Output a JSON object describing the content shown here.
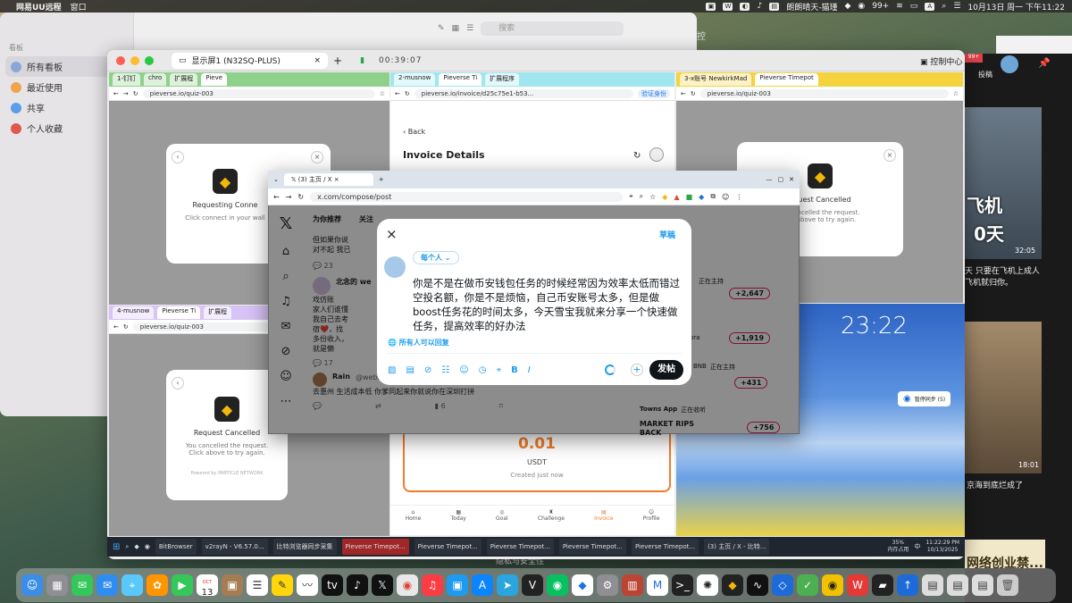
{
  "menubar": {
    "app_name": "网易UU远程",
    "menu_window": "窗口",
    "tray_badge": "99+",
    "weather": "朗朗晴天-猫瑾",
    "input_indicator": "A",
    "datetime": "10月13日 周一 下午11:22"
  },
  "finder": {
    "section": "看板",
    "items": [
      "所有看板",
      "最近使用",
      "共享",
      "个人收藏"
    ],
    "search_placeholder": "搜索",
    "control_label": "控"
  },
  "remote": {
    "tab_title": "显示屏1 (N32SQ-PLUS)",
    "timer": "00:39:07",
    "control_center": "控制中心"
  },
  "q1": {
    "tabs": [
      "1-钉钉",
      "chro",
      "扩展程",
      "Pieve"
    ],
    "url": "pieverse.io/quiz-003",
    "modal_title": "Requesting Conne",
    "modal_sub": "Click connect in your wall"
  },
  "q2": {
    "tabs": [
      "2-musnow",
      "Pieverse Ti",
      "扩展程序"
    ],
    "url": "pieverse.io/invoice/d25c75e1-b53...",
    "badge": "验证身份",
    "back": "Back",
    "title": "Invoice Details",
    "amount": "0.01",
    "currency": "USDT",
    "created": "Created just now",
    "nav": [
      "Home",
      "Today",
      "Goal",
      "Challenge",
      "Invoice",
      "Profile"
    ]
  },
  "q3": {
    "tabs": [
      "3-x账号 NewkirkMad",
      "Pieverse Timepot"
    ],
    "url": "pieverse.io/quiz-003",
    "modal_title": "equest Cancelled",
    "modal_sub1": "ou cancelled the request.",
    "modal_sub2": "lick above to try again."
  },
  "q4": {
    "tabs": [
      "4-musnow",
      "Pieverse Ti",
      "扩展程"
    ],
    "url": "pieverse.io/quiz-003",
    "modal_title": "Request Cancelled",
    "modal_sub1": "You cancelled the request.",
    "modal_sub2": "Click above to try again.",
    "powered": "Powered by PARTICLE NETWORK"
  },
  "wallpaper": {
    "clock": "23:22",
    "sync_label": "暂停同步 (5)"
  },
  "right_bg": {
    "title1": "飞机",
    "title1b": "0天",
    "dur1": "32:05",
    "text1": "天 只要在飞机上成人飞机就归你。",
    "dur2": "18:01",
    "text2": "京海到底烂成了",
    "tray": "投稿"
  },
  "xwin": {
    "tab_title": "(3) 主页 / X",
    "url": "x.com/compose/post",
    "feed_tabs": [
      "为你推荐",
      "关注"
    ],
    "feed_text1": "但如果你说",
    "feed_text2": "对不起 我已",
    "reply_count1": "23",
    "user2": "北念的 we",
    "user2_sub": "戏仿账",
    "feed_text3": "家人们谁懂",
    "feed_text4": "我自己去考",
    "feed_text5": "宿❤️，找",
    "feed_text6": "多份收入，",
    "feed_text7": "就是懒",
    "reply_count2": "17",
    "user3": "Rain",
    "user3_handle": "@web3Rain_ · 40分钟",
    "feed_text8": "去惠州 生活成本低 你爹同起来你就说你在深圳打拼",
    "views": "6",
    "right_live1": "正在主持",
    "right_count1": "+2,647",
    "right_text2": "ora",
    "right_count2": "+1,919",
    "right_text3": "BNB",
    "right_live3": "正在主持",
    "right_count3": "+431",
    "right_town": "Towns App",
    "right_live4": "正在收听",
    "right_rips": "MARKET RIPS",
    "right_rips2": "BACK",
    "right_count4": "+756"
  },
  "compose": {
    "close": "×",
    "drafts": "草稿",
    "audience": "每个人",
    "text": "你是不是在做币安钱包任务的时候经常因为效率太低而错过空投名额，你是不是烦恼，自己币安账号太多，但是做boost任务花的时间太多，今天雪宝我就来分享一个快速做任务，提高效率的好办法",
    "reply_setting": "所有人可以回复",
    "post_button": "发帖",
    "add": "+"
  },
  "taskbar": {
    "items": [
      "BitBrowser",
      "v2rayN - V6.57.0...",
      "比特浏览器同步采集",
      "Pieverse Timepot...",
      "Pieverse Timepot...",
      "Pieverse Timepot...",
      "Pieverse Timepot...",
      "Pieverse Timepot...",
      "(3) 主页 / X - 比特..."
    ],
    "cpu": "35%",
    "cpu_label": "内存占用",
    "ime": "中",
    "time": "11:22:29 PM",
    "date": "10/13/2025"
  },
  "dock": {
    "calendar_day": "13",
    "calendar_month": "OCT"
  },
  "background_text": {
    "privacy": "隐私与安全性",
    "bottom_right": "网络创业禁..."
  },
  "colors": {
    "twitter_blue": "#1d9bf0",
    "binance_yellow": "#f0b90b",
    "invoice_orange": "#f07c2b",
    "green_tab": "#8fd18a",
    "yellow_tab": "#f4d33c",
    "cyan_tab": "#9fe6ee",
    "purple_tab": "#d7c3f5"
  }
}
